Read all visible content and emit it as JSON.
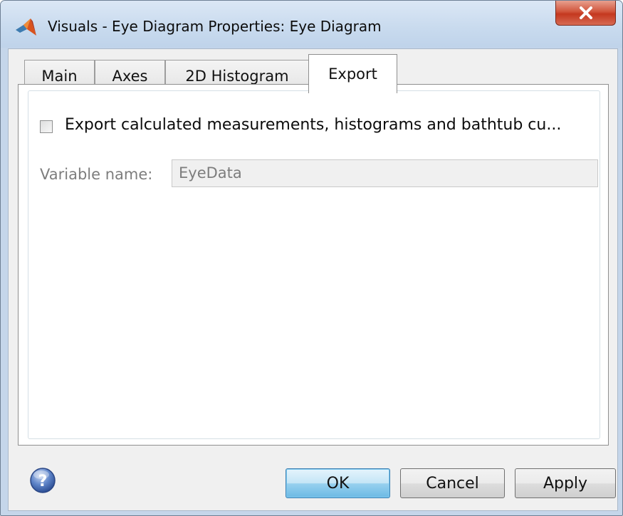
{
  "window": {
    "title": "Visuals - Eye Diagram Properties: Eye Diagram",
    "close_glyph": "x"
  },
  "tabs": [
    {
      "label": "Main",
      "active": false
    },
    {
      "label": "Axes",
      "active": false
    },
    {
      "label": "2D Histogram",
      "active": false
    },
    {
      "label": "Export",
      "active": true
    }
  ],
  "export": {
    "checkbox_label": "Export calculated measurements, histograms and bathtub cu...",
    "checkbox_checked": false,
    "variable_name_label": "Variable name:",
    "variable_name_value": "EyeData",
    "variable_name_enabled": false
  },
  "footer": {
    "help_glyph": "?",
    "ok_label": "OK",
    "cancel_label": "Cancel",
    "apply_label": "Apply"
  },
  "colors": {
    "window_frame": "#c5d6ea",
    "close_button": "#c4381f",
    "default_button": "#98d1ef",
    "disabled_text": "#7d7d7d"
  }
}
